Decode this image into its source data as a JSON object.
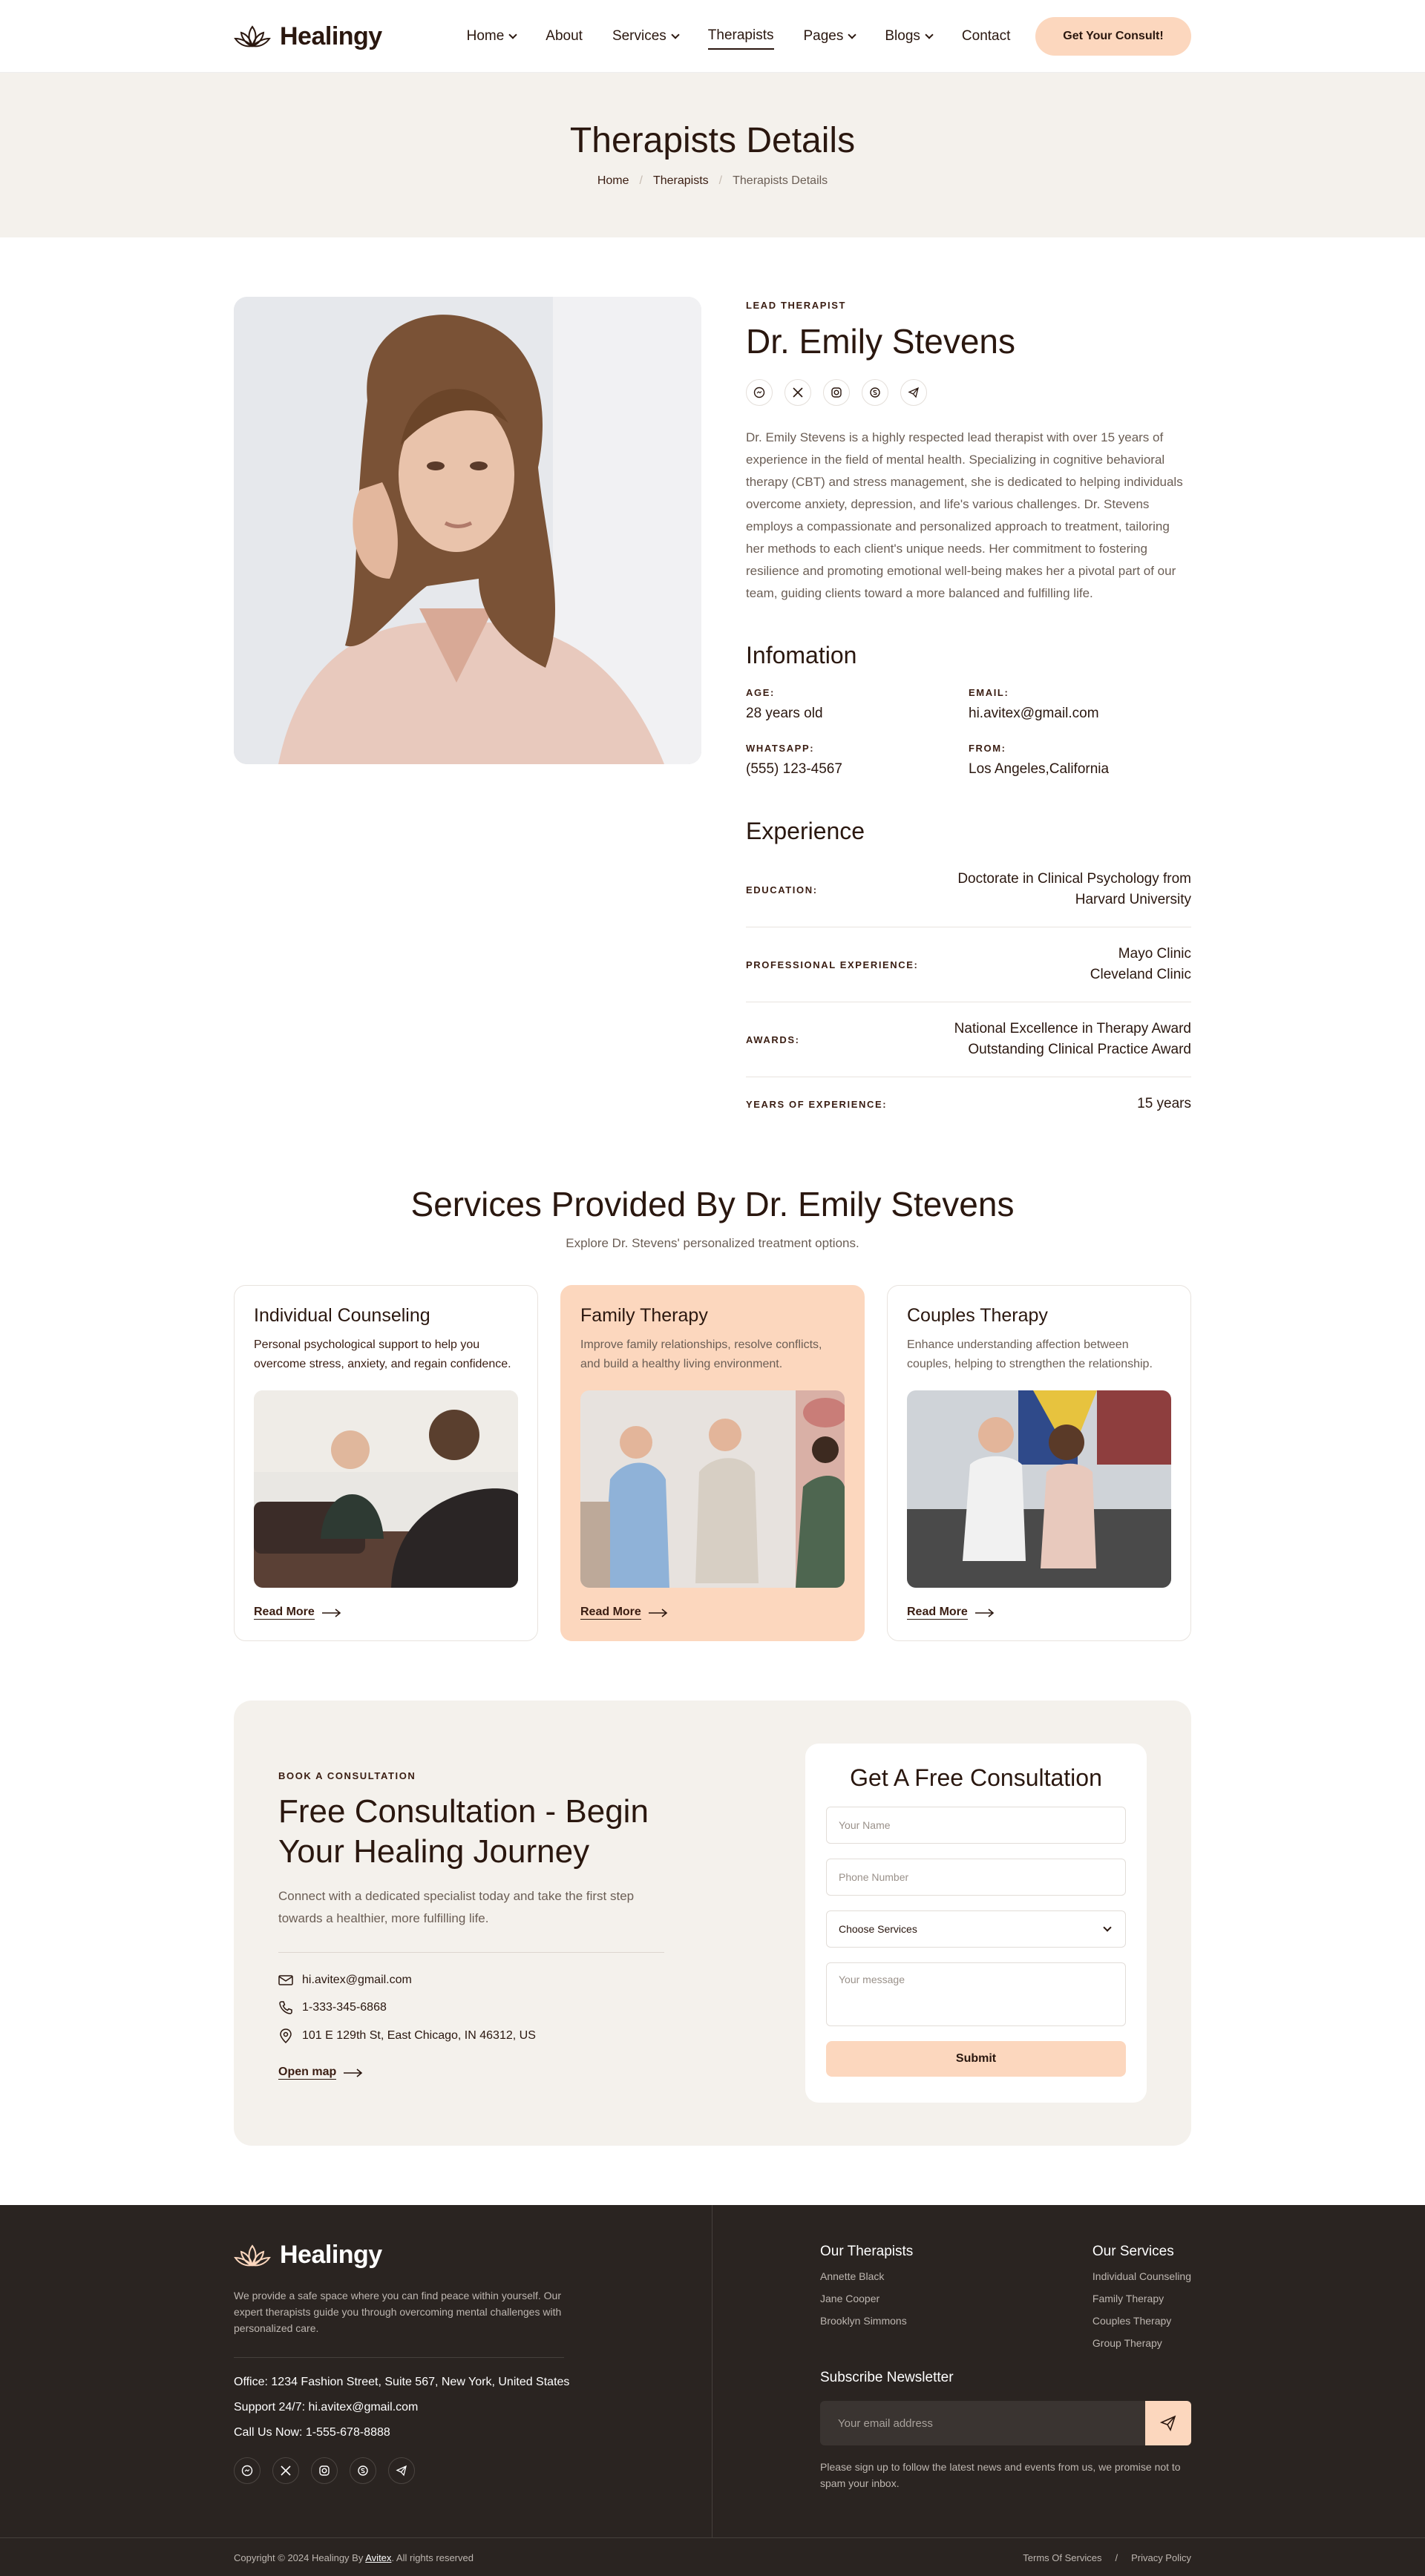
{
  "brand": {
    "name": "Healingy"
  },
  "nav": {
    "items": [
      {
        "label": "Home"
      },
      {
        "label": "About"
      },
      {
        "label": "Services"
      },
      {
        "label": "Therapists"
      },
      {
        "label": "Pages"
      },
      {
        "label": "Blogs"
      },
      {
        "label": "Contact"
      }
    ],
    "cta": "Get Your Consult!"
  },
  "hero": {
    "title": "Therapists Details",
    "breadcrumb": [
      "Home",
      "Therapists",
      "Therapists Details"
    ]
  },
  "therapist": {
    "role": "LEAD THERAPIST",
    "name": "Dr. Emily Stevens",
    "bio": "Dr. Emily Stevens is a highly respected lead therapist with over 15 years of experience in the field of mental health. Specializing in cognitive behavioral therapy (CBT) and stress management, she is dedicated to helping individuals overcome anxiety, depression, and life's various challenges. Dr. Stevens employs a compassionate and personalized approach to treatment, tailoring her methods to each client's unique needs. Her commitment to fostering resilience and promoting emotional well-being makes her a pivotal part of our team, guiding clients toward a more balanced and fulfilling life.",
    "info_title": "Infomation",
    "info": [
      {
        "label": "AGE:",
        "value": "28 years old"
      },
      {
        "label": "EMAIL:",
        "value": "hi.avitex@gmail.com"
      },
      {
        "label": "WHATSAPP:",
        "value": "(555) 123-4567"
      },
      {
        "label": "FROM:",
        "value": "Los Angeles,California"
      }
    ],
    "experience_title": "Experience",
    "experience": [
      {
        "label": "EDUCATION:",
        "lines": [
          "Doctorate in Clinical Psychology from",
          "Harvard University"
        ]
      },
      {
        "label": "PROFESSIONAL EXPERIENCE:",
        "lines": [
          "Mayo Clinic",
          "Cleveland Clinic"
        ]
      },
      {
        "label": "AWARDS:",
        "lines": [
          "National Excellence in Therapy Award",
          "Outstanding Clinical Practice Award"
        ]
      },
      {
        "label": "YEARS OF EXPERIENCE:",
        "lines": [
          "15 years",
          ""
        ]
      }
    ]
  },
  "services": {
    "title": "Services Provided By Dr. Emily Stevens",
    "subtitle": "Explore Dr. Stevens' personalized treatment options.",
    "cards": [
      {
        "title": "Individual Counseling",
        "desc": "Personal psychological support to help you overcome stress, anxiety, and regain confidence.",
        "link": "Read More"
      },
      {
        "title": "Family Therapy",
        "desc": "Improve family relationships, resolve conflicts, and build a healthy living environment.",
        "link": "Read More"
      },
      {
        "title": "Couples Therapy",
        "desc": "Enhance understanding affection between couples, helping to strengthen the relationship.",
        "link": "Read More"
      }
    ]
  },
  "consult": {
    "eyebrow": "BOOK A CONSULTATION",
    "title": "Free Consultation - Begin Your Healing Journey",
    "desc": "Connect with a dedicated specialist today and take the first step towards a healthier, more fulfilling life.",
    "email": "hi.avitex@gmail.com",
    "phone": "1-333-345-6868",
    "address": "101 E 129th St, East Chicago, IN 46312, US",
    "map_link": "Open map",
    "form": {
      "title": "Get A Free Consultation",
      "name_placeholder": "Your Name",
      "phone_placeholder": "Phone Number",
      "service_value": "Choose Services",
      "message_placeholder": "Your message",
      "submit": "Submit"
    }
  },
  "footer": {
    "about": "We provide a safe space where you can find peace within yourself. Our expert therapists guide you through overcoming mental challenges with personalized care.",
    "office": "Office: 1234 Fashion Street, Suite 567, New York, United States",
    "support": "Support 24/7: hi.avitex@gmail.com",
    "call": "Call Us Now: 1-555-678-8888",
    "therapists_title": "Our Therapists",
    "therapists": [
      "Annette Black",
      "Jane Cooper",
      "Brooklyn Simmons"
    ],
    "services_title": "Our Services",
    "services": [
      "Individual Counseling",
      "Family Therapy",
      "Couples Therapy",
      "Group Therapy"
    ],
    "newsletter_title": "Subscribe Newsletter",
    "newsletter_placeholder": "Your email address",
    "newsletter_note": "Please sign up to follow the latest news and events from us, we promise not to spam your inbox.",
    "copyright_prefix": "Copyright © 2024 Healingy By",
    "copyright_brand": "Avitex",
    "copyright_suffix": ". All rights reserved",
    "links": [
      "Terms Of Services",
      "Privacy Policy"
    ]
  },
  "colors": {
    "accent": "#fcd7be",
    "text": "#2a170f",
    "muted": "#6b5e55",
    "bg_soft": "#f4f1ec",
    "footer": "#2a2421"
  }
}
